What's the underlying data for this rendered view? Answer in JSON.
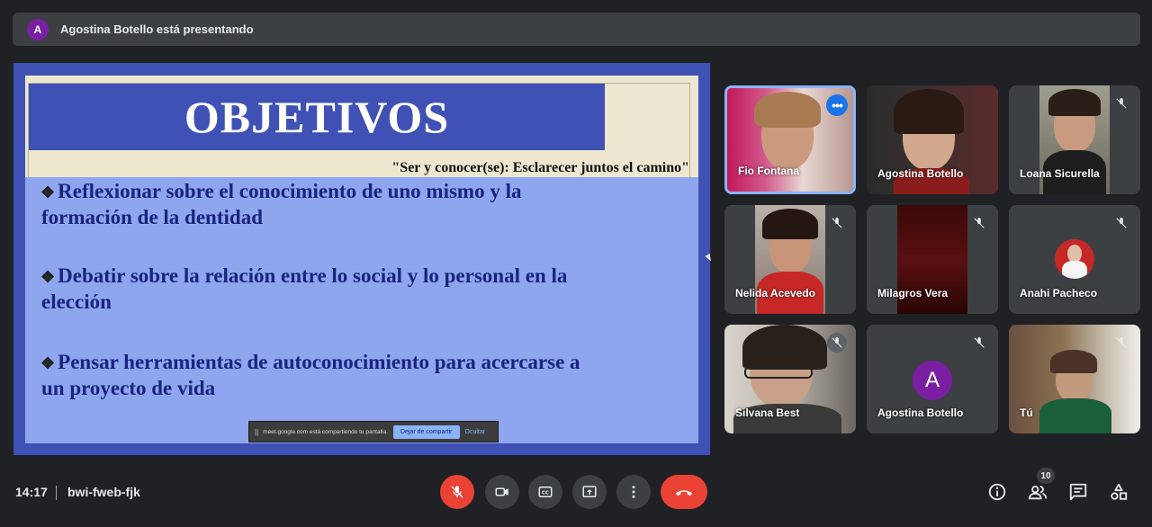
{
  "presenter_bar": {
    "avatar_initial": "A",
    "text": "Agostina Botello está presentando"
  },
  "slide": {
    "title": "OBJETIVOS",
    "subtitle": "\"Ser y conocer(se): Esclarecer juntos el camino\"",
    "bullet_symbol": "❖",
    "bullets": [
      {
        "line1": "Reflexionar sobre el conocimiento de uno mismo y la",
        "line2": "formación de la dentidad"
      },
      {
        "line1": "Debatir sobre la relación entre lo social y lo personal en la",
        "line2": "elección"
      },
      {
        "line1": "Pensar herramientas de autoconocimiento para acercarse a",
        "line2": "un proyecto de vida"
      }
    ]
  },
  "share_bar": {
    "pause_icon": "||",
    "message": "meet.google.com está compartiendo tu pantalla.",
    "stop_label": "Dejar de compartir",
    "hide_label": "Ocultar"
  },
  "participants": [
    {
      "name": "Fio Fontana",
      "muted": false,
      "active": true,
      "more_icon": "•••"
    },
    {
      "name": "Agostina Botello",
      "muted": false
    },
    {
      "name": "Loana Sicurella",
      "muted": true
    },
    {
      "name": "Nelida Acevedo",
      "muted": true
    },
    {
      "name": "Milagros Vera",
      "muted": true
    },
    {
      "name": "Anahi Pacheco",
      "muted": true
    },
    {
      "name": "Silvana Best",
      "muted": true
    },
    {
      "name": "Agostina Botello",
      "muted": true,
      "avatar_initial": "A"
    },
    {
      "name": "Tú",
      "muted": true
    }
  ],
  "bottom_bar": {
    "time": "14:17",
    "meeting_code": "bwi-fweb-fjk",
    "participant_count": "10"
  },
  "colors": {
    "background": "#202124",
    "bar": "#3c4043",
    "accent_blue": "#8ab4f8",
    "red": "#ea4335",
    "slide_blue": "#3f51b5",
    "slide_light_blue": "#8ea6ee",
    "avatar_purple": "#7b1fa2"
  }
}
